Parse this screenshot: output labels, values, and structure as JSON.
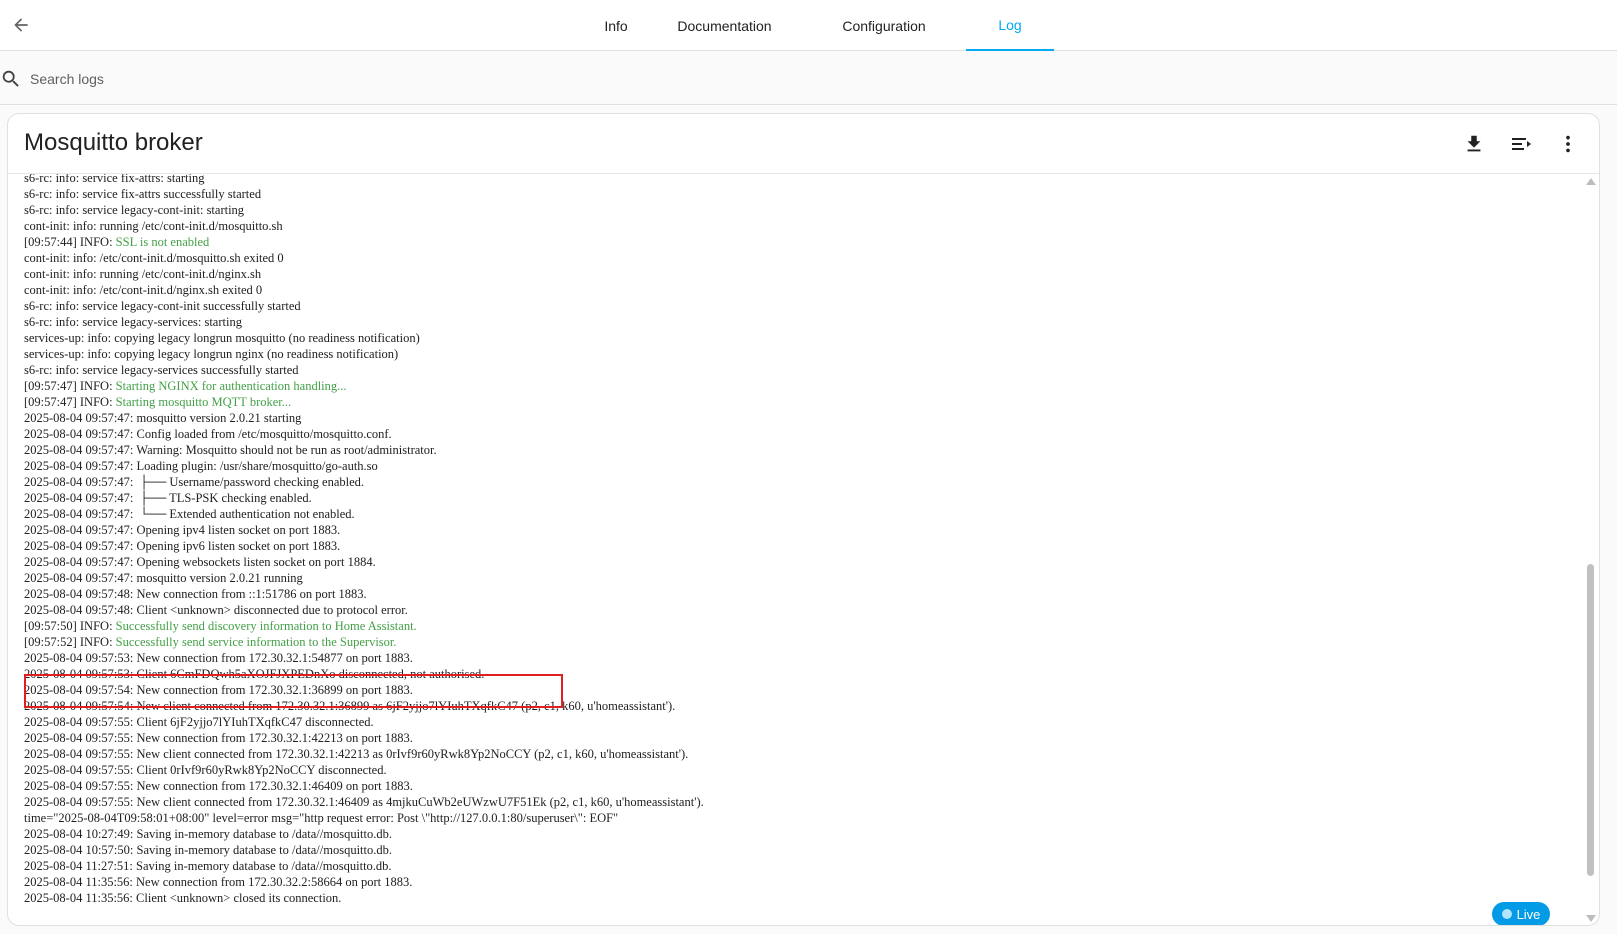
{
  "tabs": {
    "info": "Info",
    "documentation": "Documentation",
    "configuration": "Configuration",
    "log": "Log",
    "active_color": "#03a9f4"
  },
  "search": {
    "placeholder": "Search logs",
    "value": ""
  },
  "card": {
    "title": "Mosquitto broker",
    "actions": [
      "download-icon",
      "wrap-lines-icon",
      "more-vert-icon"
    ],
    "live_label": "Live"
  },
  "colors": {
    "info_message": "#43a047",
    "highlight_border": "#e02020",
    "live_badge": "#039be5"
  },
  "log": [
    {
      "prefix": "s6-rc: info: service fix-attrs: starting",
      "msg": ""
    },
    {
      "prefix": "s6-rc: info: service fix-attrs successfully started",
      "msg": ""
    },
    {
      "prefix": "s6-rc: info: service legacy-cont-init: starting",
      "msg": ""
    },
    {
      "prefix": "cont-init: info: running /etc/cont-init.d/mosquitto.sh",
      "msg": ""
    },
    {
      "prefix": "[09:57:44] INFO: ",
      "msg": "SSL is not enabled"
    },
    {
      "prefix": "cont-init: info: /etc/cont-init.d/mosquitto.sh exited 0",
      "msg": ""
    },
    {
      "prefix": "cont-init: info: running /etc/cont-init.d/nginx.sh",
      "msg": ""
    },
    {
      "prefix": "cont-init: info: /etc/cont-init.d/nginx.sh exited 0",
      "msg": ""
    },
    {
      "prefix": "s6-rc: info: service legacy-cont-init successfully started",
      "msg": ""
    },
    {
      "prefix": "s6-rc: info: service legacy-services: starting",
      "msg": ""
    },
    {
      "prefix": "services-up: info: copying legacy longrun mosquitto (no readiness notification)",
      "msg": ""
    },
    {
      "prefix": "services-up: info: copying legacy longrun nginx (no readiness notification)",
      "msg": ""
    },
    {
      "prefix": "s6-rc: info: service legacy-services successfully started",
      "msg": ""
    },
    {
      "prefix": "[09:57:47] INFO: ",
      "msg": "Starting NGINX for authentication handling..."
    },
    {
      "prefix": "[09:57:47] INFO: ",
      "msg": "Starting mosquitto MQTT broker..."
    },
    {
      "prefix": "2025-08-04 09:57:47: mosquitto version 2.0.21 starting",
      "msg": ""
    },
    {
      "prefix": "2025-08-04 09:57:47: Config loaded from /etc/mosquitto/mosquitto.conf.",
      "msg": ""
    },
    {
      "prefix": "2025-08-04 09:57:47: Warning: Mosquitto should not be run as root/administrator.",
      "msg": ""
    },
    {
      "prefix": "2025-08-04 09:57:47: Loading plugin: /usr/share/mosquitto/go-auth.so",
      "msg": ""
    },
    {
      "prefix": "2025-08-04 09:57:47:  ├── Username/password checking enabled.",
      "msg": ""
    },
    {
      "prefix": "2025-08-04 09:57:47:  ├── TLS-PSK checking enabled.",
      "msg": ""
    },
    {
      "prefix": "2025-08-04 09:57:47:  └── Extended authentication not enabled.",
      "msg": ""
    },
    {
      "prefix": "2025-08-04 09:57:47: Opening ipv4 listen socket on port 1883.",
      "msg": ""
    },
    {
      "prefix": "2025-08-04 09:57:47: Opening ipv6 listen socket on port 1883.",
      "msg": ""
    },
    {
      "prefix": "2025-08-04 09:57:47: Opening websockets listen socket on port 1884.",
      "msg": ""
    },
    {
      "prefix": "2025-08-04 09:57:47: mosquitto version 2.0.21 running",
      "msg": ""
    },
    {
      "prefix": "2025-08-04 09:57:48: New connection from ::1:51786 on port 1883.",
      "msg": ""
    },
    {
      "prefix": "2025-08-04 09:57:48: Client <unknown> disconnected due to protocol error.",
      "msg": ""
    },
    {
      "prefix": "[09:57:50] INFO: ",
      "msg": "Successfully send discovery information to Home Assistant."
    },
    {
      "prefix": "[09:57:52] INFO: ",
      "msg": "Successfully send service information to the Supervisor."
    },
    {
      "prefix": "2025-08-04 09:57:53: New connection from 172.30.32.1:54877 on port 1883.",
      "msg": ""
    },
    {
      "prefix": "2025-08-04 09:57:53: Client 6CmFDQwh5aXOJFJXPEDnXo disconnected, not authorised.",
      "msg": ""
    },
    {
      "prefix": "2025-08-04 09:57:54: New connection from 172.30.32.1:36899 on port 1883.",
      "msg": ""
    },
    {
      "prefix": "2025-08-04 09:57:54: New client connected from 172.30.32.1:36899 as 6jF2yjjo7lYIuhTXqfkC47 (p2, c1, k60, u'homeassistant').",
      "msg": ""
    },
    {
      "prefix": "2025-08-04 09:57:55: Client 6jF2yjjo7lYIuhTXqfkC47 disconnected.",
      "msg": ""
    },
    {
      "prefix": "2025-08-04 09:57:55: New connection from 172.30.32.1:42213 on port 1883.",
      "msg": ""
    },
    {
      "prefix": "2025-08-04 09:57:55: New client connected from 172.30.32.1:42213 as 0rIvf9r60yRwk8Yp2NoCCY (p2, c1, k60, u'homeassistant').",
      "msg": ""
    },
    {
      "prefix": "2025-08-04 09:57:55: Client 0rIvf9r60yRwk8Yp2NoCCY disconnected.",
      "msg": ""
    },
    {
      "prefix": "2025-08-04 09:57:55: New connection from 172.30.32.1:46409 on port 1883.",
      "msg": ""
    },
    {
      "prefix": "2025-08-04 09:57:55: New client connected from 172.30.32.1:46409 as 4mjkuCuWb2eUWzwU7F51Ek (p2, c1, k60, u'homeassistant').",
      "msg": ""
    },
    {
      "prefix": "time=\"2025-08-04T09:58:01+08:00\" level=error msg=\"http request error: Post \\\"http://127.0.0.1:80/superuser\\\": EOF\"",
      "msg": ""
    },
    {
      "prefix": "2025-08-04 10:27:49: Saving in-memory database to /data//mosquitto.db.",
      "msg": ""
    },
    {
      "prefix": "2025-08-04 10:57:50: Saving in-memory database to /data//mosquitto.db.",
      "msg": ""
    },
    {
      "prefix": "2025-08-04 11:27:51: Saving in-memory database to /data//mosquitto.db.",
      "msg": ""
    },
    {
      "prefix": "2025-08-04 11:35:56: New connection from 172.30.32.2:58664 on port 1883.",
      "msg": ""
    },
    {
      "prefix": "2025-08-04 11:35:56: Client <unknown> closed its connection.",
      "msg": ""
    }
  ]
}
